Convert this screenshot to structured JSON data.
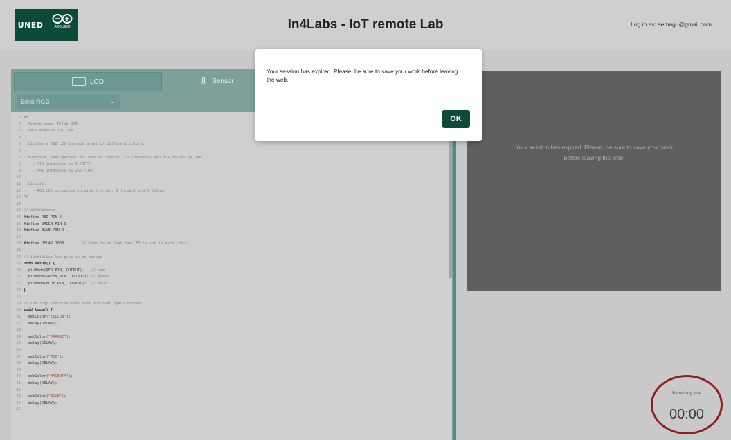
{
  "header": {
    "logo_text": "UNED",
    "logo_arduino_text": "ARDUINO",
    "title": "In4Labs - IoT remote Lab",
    "login": "Log in as: semagu@gmail.com"
  },
  "tabs": [
    {
      "label": "LCD",
      "icon": "lcd-icon"
    },
    {
      "label": "Sensor",
      "icon": "sensor-icon"
    }
  ],
  "sketch_select": {
    "value": "Blink RGB"
  },
  "code_lines": [
    [
      [
        "d",
        "/*"
      ]
    ],
    [
      [
        "c",
        "  Sketch name: Blink RGB"
      ]
    ],
    [
      [
        "c",
        "  UNED Arduino IoT lab."
      ]
    ],
    [
      [
        "c",
        ""
      ]
    ],
    [
      [
        "c",
        "  Circles a RGB LED through a set of different colors."
      ]
    ],
    [
      [
        "c",
        ""
      ]
    ],
    [
      [
        "c",
        "  Function 'analogWrite' is used to control LED intensity and mix colors by PWM:"
      ]
    ],
    [
      [
        "c",
        "    - MIN intensity is 0 (OFF)"
      ]
    ],
    [
      [
        "c",
        "    - MAX intensity is 256 (ON)"
      ]
    ],
    [
      [
        "c",
        ""
      ]
    ],
    [
      [
        "c",
        "  Circuit:"
      ]
    ],
    [
      [
        "c",
        "    - RGB LED connected to pins 5 (red), 6 (green) and 9 (blue)"
      ]
    ],
    [
      [
        "d",
        "*/"
      ]
    ],
    [
      [
        "d",
        ""
      ]
    ],
    [
      [
        "c",
        "// definitions"
      ]
    ],
    [
      [
        "d",
        "#define RED_PIN 5"
      ]
    ],
    [
      [
        "d",
        "#define GREEN_PIN 6"
      ]
    ],
    [
      [
        "d",
        "#define BLUE_PIN 9"
      ]
    ],
    [
      [
        "d",
        ""
      ]
    ],
    [
      [
        "d",
        "#define DELAY 1000"
      ],
      [
        "c",
        "        // time in ms that the LED is set in each color"
      ]
    ],
    [
      [
        "d",
        ""
      ]
    ],
    [
      [
        "c",
        "// initialize led pins as an output"
      ]
    ],
    [
      [
        "k",
        "void setup() {"
      ]
    ],
    [
      [
        "d",
        "  pinMode(RED_PIN, OUTPUT);   "
      ],
      [
        "c",
        "// red"
      ]
    ],
    [
      [
        "d",
        "  pinMode(GREEN_PIN, OUTPUT); "
      ],
      [
        "c",
        "// green"
      ]
    ],
    [
      [
        "d",
        "  pinMode(BLUE_PIN, OUTPUT);  "
      ],
      [
        "c",
        "// blue"
      ]
    ],
    [
      [
        "k",
        "}"
      ]
    ],
    [
      [
        "d",
        ""
      ]
    ],
    [
      [
        "c",
        "// the loop function runs over and over again forever"
      ]
    ],
    [
      [
        "k",
        "void loop() {"
      ]
    ],
    [
      [
        "d",
        "  setColor("
      ],
      [
        "s",
        "\"YELLOW\""
      ],
      [
        "d",
        ");"
      ]
    ],
    [
      [
        "d",
        "  delay(DELAY);"
      ]
    ],
    [
      [
        "d",
        ""
      ]
    ],
    [
      [
        "d",
        "  setColor("
      ],
      [
        "s",
        "\"ORANGE\""
      ],
      [
        "d",
        ");"
      ]
    ],
    [
      [
        "d",
        "  delay(DELAY);"
      ]
    ],
    [
      [
        "d",
        ""
      ]
    ],
    [
      [
        "d",
        "  setColor("
      ],
      [
        "s",
        "\"RED\""
      ],
      [
        "d",
        ");"
      ]
    ],
    [
      [
        "d",
        "  delay(DELAY);"
      ]
    ],
    [
      [
        "d",
        ""
      ]
    ],
    [
      [
        "d",
        "  setColor("
      ],
      [
        "s",
        "\"MAGENTA\""
      ],
      [
        "d",
        ");"
      ]
    ],
    [
      [
        "d",
        "  delay(DELAY);"
      ]
    ],
    [
      [
        "d",
        ""
      ]
    ],
    [
      [
        "d",
        "  setColor("
      ],
      [
        "s",
        "\"BLUE\""
      ],
      [
        "d",
        ");"
      ]
    ],
    [
      [
        "d",
        "  delay(DELAY);"
      ]
    ],
    [
      [
        "d",
        ""
      ]
    ]
  ],
  "video": {
    "message": "Your session has expired. Please, be sure to save your work before leaving the web."
  },
  "timer": {
    "label": "Remaining time",
    "value": "00:00"
  },
  "modal": {
    "message": "Your session has expired. Please, be sure to save your work before leaving the web.",
    "ok_label": "OK"
  },
  "colors": {
    "brand": "#0c4a3a",
    "teal": "#4e8d86",
    "timer_ring": "#8e2024"
  }
}
